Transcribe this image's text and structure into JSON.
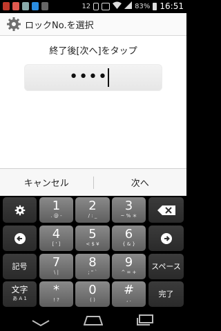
{
  "status_bar": {
    "notif_count": "12",
    "battery": "83%",
    "time": "16:51"
  },
  "title_bar": {
    "title": "ロックNo.を選択",
    "icon": "gear-icon"
  },
  "content": {
    "instruction": "終了後[次へ]をタップ",
    "password_value": "••••"
  },
  "buttons": {
    "cancel": "キャンセル",
    "next": "次へ"
  },
  "keyboard": {
    "rows": [
      [
        {
          "name": "keyboard-settings-key",
          "icon": "gear-icon",
          "type": "dark"
        },
        {
          "name": "key-1",
          "main": "1",
          "sub": ". @ -",
          "type": "num"
        },
        {
          "name": "key-2",
          "main": "2",
          "sub": "/ : _",
          "type": "num"
        },
        {
          "name": "key-3",
          "main": "3",
          "sub": "~ % ＊",
          "type": "num"
        },
        {
          "name": "backspace-key",
          "icon": "backspace-icon",
          "type": "dark"
        }
      ],
      [
        {
          "name": "left-arrow-key",
          "icon": "left-arrow-icon",
          "type": "dark"
        },
        {
          "name": "key-4",
          "main": "4",
          "sub": "[ ' ]",
          "type": "num"
        },
        {
          "name": "key-5",
          "main": "5",
          "sub": "< $ ¥",
          "type": "num"
        },
        {
          "name": "key-6",
          "main": "6",
          "sub": "{ & }",
          "type": "num"
        },
        {
          "name": "right-arrow-key",
          "icon": "right-arrow-icon",
          "type": "dark"
        }
      ],
      [
        {
          "name": "symbol-key",
          "label": "記号",
          "type": "dark"
        },
        {
          "name": "key-7",
          "main": "7",
          "sub": "\\ |",
          "type": "num"
        },
        {
          "name": "key-8",
          "main": "8",
          "sub": "; \" `",
          "type": "num"
        },
        {
          "name": "key-9",
          "main": "9",
          "sub": "^ = +",
          "type": "num"
        },
        {
          "name": "space-key",
          "label": "スペース",
          "type": "dark"
        }
      ],
      [
        {
          "name": "input-mode-key",
          "label": "文字",
          "sub": "あ A 1",
          "type": "dark"
        },
        {
          "name": "key-asterisk",
          "main": "*",
          "sub": "! ?",
          "type": "num"
        },
        {
          "name": "key-0",
          "main": "0",
          "sub": "( )",
          "type": "num"
        },
        {
          "name": "key-hash",
          "main": "#",
          "sub": ", .",
          "type": "num"
        },
        {
          "name": "done-key",
          "label": "完了",
          "type": "dark"
        }
      ]
    ]
  },
  "nav_bar": {
    "back": "back-icon",
    "home": "home-icon",
    "recents": "recents-icon"
  }
}
